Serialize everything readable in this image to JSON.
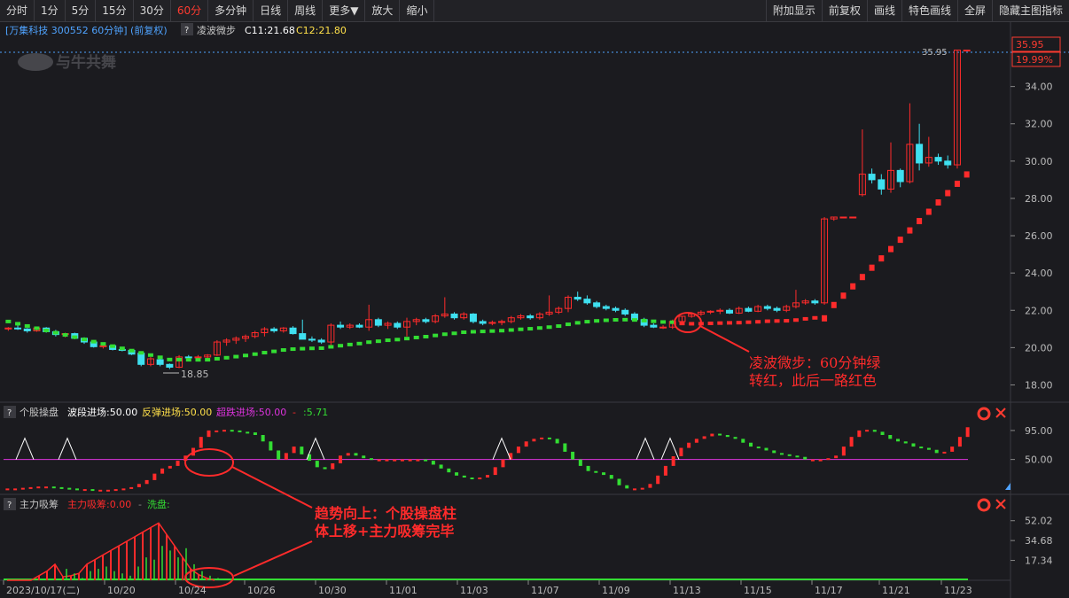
{
  "toolbar": {
    "left": [
      "分时",
      "1分",
      "5分",
      "15分",
      "30分",
      "60分",
      "多分钟",
      "日线",
      "周线",
      "更多▼",
      "放大",
      "缩小"
    ],
    "active": "60分",
    "right": [
      "附加显示",
      "前复权",
      "画线",
      "特色画线",
      "全屏",
      "隐藏主图指标"
    ]
  },
  "main_panel": {
    "title": "[万集科技 300552 60分钟] (前复权)",
    "indicator_btn": "?",
    "indicator_name": "凌波微步",
    "c1_label": "C11:21.68",
    "c2_label": "C12:21.80",
    "last_price": "35.95",
    "last_pct": "19.99%",
    "high_label": "35.95",
    "low_label": "18.85",
    "watermark": "与牛共舞",
    "annotation": [
      "凌波微步：60分钟绿",
      "转红，此后一路红色"
    ]
  },
  "panel2": {
    "btn": "?",
    "name": "个股操盘",
    "label1": "波段进场:50.00",
    "label2": "反弹进场:50.00",
    "label3": "超跌进场:50.00",
    "label4": ":5.71"
  },
  "panel3": {
    "btn": "?",
    "name": "主力吸筹",
    "label1": "主力吸筹:0.00",
    "label2": "洗盘:"
  },
  "annotation_mid": [
    "趋势向上：个股操盘柱",
    "体上移+主力吸筹完毕"
  ],
  "x_axis": [
    "2023/10/17(二)",
    "10/20",
    "10/24",
    "10/26",
    "10/30",
    "11/01",
    "11/03",
    "11/07",
    "11/09",
    "11/13",
    "11/15",
    "11/17",
    "11/21",
    "11/23"
  ],
  "colors": {
    "up": "#ff2b2b",
    "down": "#3fe0f0",
    "green": "#33dd33",
    "bg": "#1b1b1f",
    "grid": "#3a3a40",
    "magenta": "#dd33dd"
  },
  "chart_data": [
    {
      "type": "candlestick",
      "title": "万集科技 300552 60分钟",
      "ylim": [
        17.5,
        36.5
      ],
      "yticks": [
        18.0,
        20.0,
        22.0,
        24.0,
        26.0,
        28.0,
        30.0,
        32.0,
        34.0
      ],
      "candles": [
        [
          21.0,
          21.1,
          20.9,
          21.05
        ],
        [
          21.05,
          21.2,
          20.95,
          21.0
        ],
        [
          21.0,
          21.05,
          20.8,
          20.9
        ],
        [
          20.9,
          21.1,
          20.85,
          21.05
        ],
        [
          21.05,
          21.1,
          20.8,
          20.85
        ],
        [
          20.85,
          20.95,
          20.6,
          20.7
        ],
        [
          20.7,
          20.8,
          20.55,
          20.75
        ],
        [
          20.75,
          20.8,
          20.45,
          20.5
        ],
        [
          20.5,
          20.55,
          20.2,
          20.3
        ],
        [
          20.3,
          20.4,
          20.0,
          20.05
        ],
        [
          20.05,
          20.2,
          19.95,
          20.1
        ],
        [
          20.1,
          20.15,
          19.85,
          19.9
        ],
        [
          19.9,
          19.95,
          19.8,
          19.85
        ],
        [
          19.85,
          19.9,
          19.6,
          19.65
        ],
        [
          19.7,
          19.75,
          19.0,
          19.1
        ],
        [
          19.1,
          19.5,
          19.0,
          19.4
        ],
        [
          19.35,
          19.4,
          19.0,
          19.1
        ],
        [
          19.1,
          19.15,
          18.85,
          18.95
        ],
        [
          18.95,
          19.6,
          18.9,
          19.5
        ],
        [
          19.5,
          19.6,
          19.3,
          19.45
        ],
        [
          19.45,
          19.6,
          19.4,
          19.5
        ],
        [
          19.5,
          19.65,
          19.4,
          19.6
        ],
        [
          19.6,
          20.4,
          19.55,
          20.3
        ],
        [
          20.3,
          20.5,
          20.1,
          20.4
        ],
        [
          20.4,
          20.6,
          20.2,
          20.5
        ],
        [
          20.5,
          20.7,
          20.3,
          20.6
        ],
        [
          20.6,
          20.9,
          20.5,
          20.8
        ],
        [
          20.8,
          21.1,
          20.6,
          21.0
        ],
        [
          21.0,
          21.1,
          20.8,
          20.9
        ],
        [
          20.9,
          21.1,
          20.8,
          21.05
        ],
        [
          21.05,
          21.15,
          20.7,
          20.75
        ],
        [
          20.75,
          21.5,
          20.5,
          20.45
        ],
        [
          20.45,
          20.6,
          20.3,
          20.4
        ],
        [
          20.4,
          20.5,
          20.2,
          20.3
        ],
        [
          20.3,
          21.3,
          20.1,
          21.2
        ],
        [
          21.2,
          21.4,
          21.0,
          21.1
        ],
        [
          21.1,
          21.3,
          21.0,
          21.2
        ],
        [
          21.2,
          21.3,
          21.05,
          21.1
        ],
        [
          21.1,
          22.3,
          20.9,
          21.5
        ],
        [
          21.5,
          21.6,
          21.1,
          21.2
        ],
        [
          21.2,
          21.4,
          21.0,
          21.3
        ],
        [
          21.3,
          21.4,
          21.0,
          21.1
        ],
        [
          21.1,
          21.6,
          20.6,
          21.4
        ],
        [
          21.4,
          21.6,
          21.2,
          21.5
        ],
        [
          21.5,
          21.6,
          21.3,
          21.4
        ],
        [
          21.4,
          21.8,
          21.3,
          21.7
        ],
        [
          21.7,
          22.7,
          21.6,
          21.8
        ],
        [
          21.8,
          21.9,
          21.5,
          21.6
        ],
        [
          21.6,
          21.9,
          21.5,
          21.8
        ],
        [
          21.8,
          21.85,
          21.3,
          21.4
        ],
        [
          21.4,
          21.5,
          21.2,
          21.3
        ],
        [
          21.3,
          21.45,
          21.2,
          21.35
        ],
        [
          21.35,
          21.5,
          21.2,
          21.4
        ],
        [
          21.4,
          21.7,
          21.3,
          21.6
        ],
        [
          21.6,
          21.8,
          21.5,
          21.7
        ],
        [
          21.7,
          21.8,
          21.5,
          21.6
        ],
        [
          21.6,
          21.9,
          21.5,
          21.8
        ],
        [
          21.8,
          22.8,
          21.7,
          21.9
        ],
        [
          21.9,
          22.2,
          21.8,
          22.1
        ],
        [
          22.1,
          22.8,
          21.9,
          22.7
        ],
        [
          22.7,
          23.0,
          22.5,
          22.6
        ],
        [
          22.6,
          22.8,
          22.3,
          22.4
        ],
        [
          22.4,
          22.5,
          22.1,
          22.2
        ],
        [
          22.2,
          22.3,
          22.0,
          22.1
        ],
        [
          22.1,
          22.2,
          21.9,
          22.0
        ],
        [
          22.0,
          22.1,
          21.7,
          21.8
        ],
        [
          21.8,
          21.9,
          21.4,
          21.5
        ],
        [
          21.5,
          21.6,
          21.1,
          21.2
        ],
        [
          21.2,
          21.3,
          21.05,
          21.1
        ],
        [
          21.1,
          21.2,
          21.0,
          21.1
        ],
        [
          21.1,
          21.5,
          21.0,
          21.4
        ],
        [
          21.4,
          21.7,
          21.3,
          21.68
        ],
        [
          21.68,
          21.9,
          21.6,
          21.8
        ],
        [
          21.8,
          22.0,
          21.7,
          21.9
        ],
        [
          21.9,
          22.0,
          21.8,
          21.95
        ],
        [
          21.95,
          22.1,
          21.8,
          22.0
        ],
        [
          22.0,
          22.1,
          21.8,
          21.85
        ],
        [
          21.85,
          22.2,
          21.8,
          22.1
        ],
        [
          22.1,
          22.2,
          21.9,
          21.95
        ],
        [
          21.95,
          22.3,
          21.9,
          22.2
        ],
        [
          22.2,
          22.3,
          22.0,
          22.1
        ],
        [
          22.1,
          22.2,
          21.9,
          22.0
        ],
        [
          22.0,
          22.3,
          21.9,
          22.2
        ],
        [
          22.2,
          23.1,
          22.1,
          22.4
        ],
        [
          22.4,
          22.6,
          22.3,
          22.5
        ],
        [
          22.5,
          22.6,
          22.3,
          22.4
        ],
        [
          22.4,
          27.0,
          22.3,
          26.9
        ],
        [
          26.9,
          27.0,
          26.8,
          27.0
        ],
        [
          27.0,
          27.0,
          27.0,
          27.0
        ],
        [
          27.0,
          27.0,
          27.0,
          27.0
        ],
        [
          28.2,
          31.7,
          28.1,
          29.3
        ],
        [
          29.3,
          29.6,
          28.8,
          29.0
        ],
        [
          29.0,
          29.3,
          28.2,
          28.5
        ],
        [
          28.5,
          31.0,
          28.3,
          29.5
        ],
        [
          29.5,
          29.6,
          28.6,
          28.9
        ],
        [
          28.9,
          33.1,
          28.8,
          30.9
        ],
        [
          30.9,
          32.0,
          29.5,
          29.9
        ],
        [
          29.9,
          31.3,
          29.7,
          30.2
        ],
        [
          30.2,
          30.4,
          29.8,
          30.0
        ],
        [
          30.0,
          30.3,
          29.6,
          29.8
        ],
        [
          29.8,
          35.95,
          29.6,
          35.95
        ],
        [
          35.95,
          35.95,
          35.95,
          35.95
        ]
      ],
      "trend_line": {
        "colors_by_segment": [
          "green",
          "green",
          "red"
        ],
        "turn_index": 71
      }
    },
    {
      "type": "line",
      "title": "个股操盘",
      "ylim": [
        0,
        110
      ],
      "yticks": [
        50.0,
        95.0
      ],
      "series": [
        {
          "name": "个股操盘",
          "values": [
            5,
            5,
            6,
            7,
            8,
            8,
            7,
            6,
            5,
            4,
            4,
            3,
            3,
            3,
            4,
            5,
            7,
            12,
            18,
            28,
            36,
            40,
            48,
            56,
            68,
            85,
            95,
            95,
            96,
            95,
            93,
            92,
            88,
            78,
            64,
            50,
            60,
            70,
            58,
            48,
            38,
            35,
            44,
            56,
            60,
            56,
            52,
            50,
            50,
            50,
            50,
            50,
            50,
            50,
            48,
            42,
            36,
            30,
            25,
            22,
            20,
            22,
            26,
            38,
            50,
            60,
            70,
            78,
            82,
            84,
            82,
            75,
            62,
            50,
            40,
            32,
            30,
            26,
            20,
            10,
            5,
            5,
            6,
            12,
            25,
            40,
            55,
            68,
            76,
            82,
            86,
            90,
            88,
            85,
            82,
            76,
            70,
            68,
            64,
            60,
            58,
            56,
            54,
            50,
            50,
            50,
            52,
            56,
            70,
            85,
            95,
            96,
            93,
            88,
            82,
            78,
            75,
            70,
            68,
            65,
            60,
            62,
            70,
            85,
            100
          ]
        }
      ],
      "reference_line": 50
    },
    {
      "type": "bar",
      "title": "主力吸筹",
      "ylim": [
        0,
        58
      ],
      "yticks": [
        17.34,
        34.68,
        52.02
      ],
      "series": [
        {
          "name": "主力吸筹",
          "values": [
            0,
            0,
            0,
            0,
            4,
            8,
            14,
            3,
            4,
            6,
            14,
            18,
            22,
            26,
            30,
            34,
            38,
            42,
            46,
            50,
            40,
            30,
            20,
            10,
            5,
            2,
            0
          ]
        },
        {
          "name": "洗盘",
          "values": [
            0,
            0,
            0,
            0,
            0,
            0,
            0,
            10,
            6,
            2,
            8,
            10,
            12,
            8,
            6,
            4,
            12,
            20,
            18,
            30,
            26,
            20,
            28,
            14,
            8,
            4,
            2
          ]
        }
      ]
    }
  ]
}
